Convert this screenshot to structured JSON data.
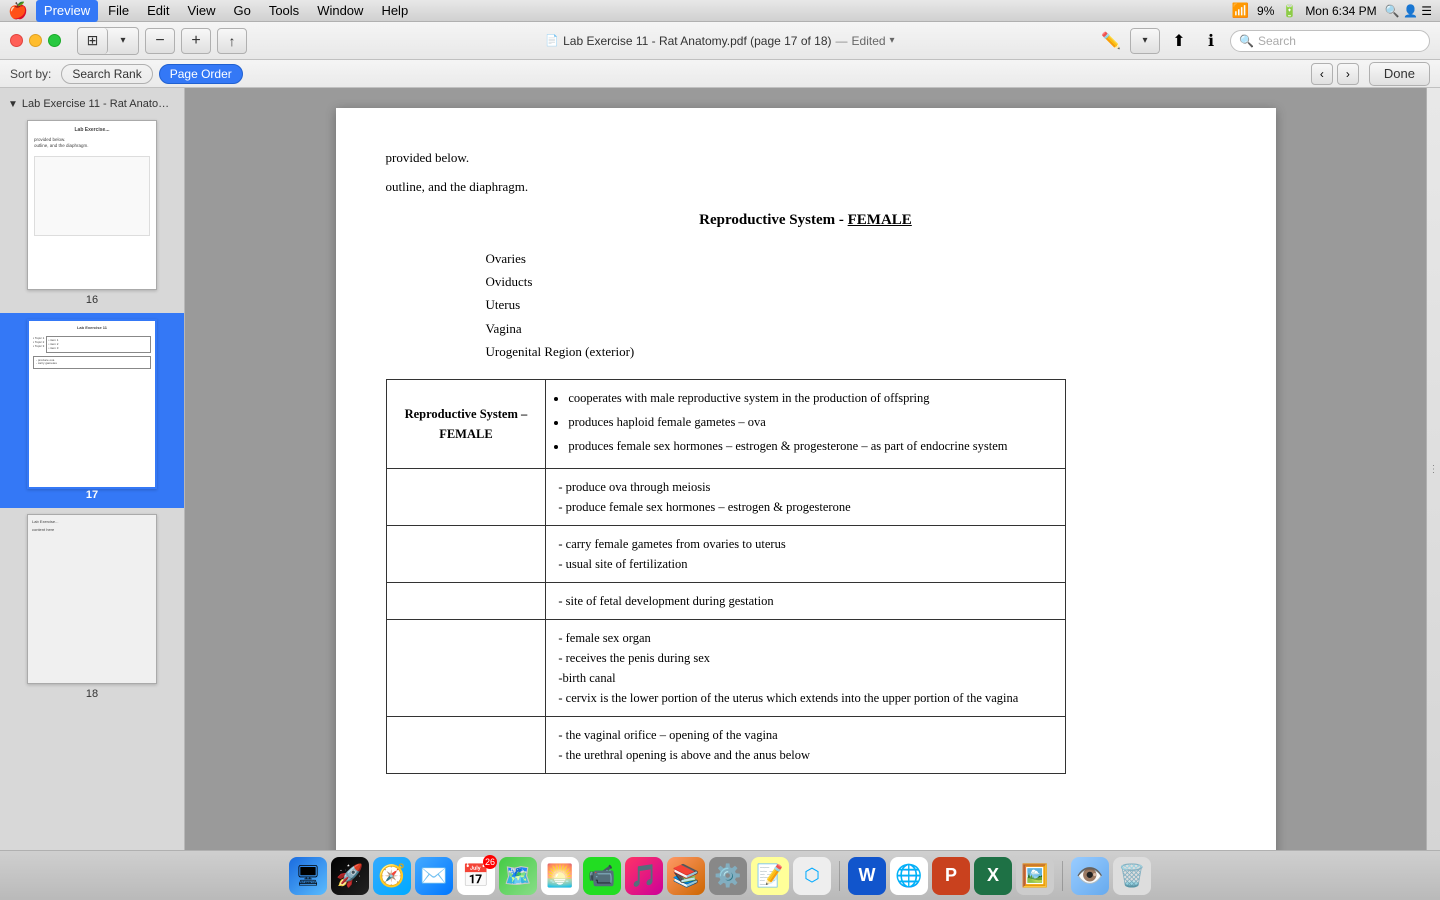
{
  "menubar": {
    "apple": "🍎",
    "items": [
      "Preview",
      "File",
      "Edit",
      "View",
      "Go",
      "Tools",
      "Window",
      "Help"
    ],
    "active": "Preview",
    "time": "Mon 6:34 PM",
    "battery": "9%"
  },
  "toolbar": {
    "title": "Lab Exercise 11 - Rat Anatomy.pdf (page 17 of 18)",
    "edited_label": "Edited",
    "search_placeholder": "Search"
  },
  "sortbar": {
    "sort_label": "Sort by:",
    "sort_buttons": [
      "Search Rank",
      "Page Order"
    ],
    "active_sort": "Page Order",
    "done_label": "Done"
  },
  "sidebar": {
    "pages": [
      {
        "num": "16",
        "active": false
      },
      {
        "num": "17",
        "active": true
      },
      {
        "num": "18",
        "active": false
      }
    ]
  },
  "document": {
    "page17": {
      "intro_text1": "provided below.",
      "intro_text2": "outline, and the diaphragm.",
      "section_title_prefix": "Reproductive System - ",
      "section_title_underline": "FEMALE",
      "list_items": [
        "Ovaries",
        "Oviducts",
        "Uterus",
        "Vagina",
        "Urogenital Region (exterior)"
      ],
      "table": {
        "header_col1": "Reproductive System – FEMALE",
        "rows": [
          {
            "col1": "",
            "col2_bullets": [
              "cooperates with male reproductive system in the production of offspring",
              "produces haploid female gametes – ova",
              "produces female sex hormones – estrogen & progesterone – as part of endocrine system"
            ]
          },
          {
            "col1": "",
            "col2_lines": [
              "- produce ova through meiosis",
              "- produce female sex hormones – estrogen & progesterone"
            ]
          },
          {
            "col1": "",
            "col2_lines": [
              "- carry female gametes from ovaries to uterus",
              "- usual site of fertilization"
            ]
          },
          {
            "col1": "",
            "col2_lines": [
              "- site of fetal development during gestation"
            ]
          },
          {
            "col1": "",
            "col2_lines": [
              "- female sex organ",
              "- receives the penis during sex",
              "-birth canal",
              "- cervix is the lower portion of the uterus which extends into the upper portion of the vagina"
            ]
          },
          {
            "col1": "",
            "col2_lines": [
              "- the vaginal orifice – opening of the vagina",
              "- the urethral opening is above and the anus below"
            ]
          }
        ]
      }
    }
  },
  "dock": {
    "icons": [
      {
        "name": "Finder",
        "emoji": "🔵",
        "badge": ""
      },
      {
        "name": "Launchpad",
        "emoji": "🚀",
        "badge": ""
      },
      {
        "name": "Safari",
        "emoji": "🧭",
        "badge": ""
      },
      {
        "name": "Mail",
        "emoji": "📧",
        "badge": ""
      },
      {
        "name": "Calendar",
        "emoji": "📅",
        "badge": "26"
      },
      {
        "name": "Maps",
        "emoji": "🗺️",
        "badge": ""
      },
      {
        "name": "Photos",
        "emoji": "🌅",
        "badge": ""
      },
      {
        "name": "FaceTime",
        "emoji": "📹",
        "badge": ""
      },
      {
        "name": "Music",
        "emoji": "🎵",
        "badge": ""
      },
      {
        "name": "Books",
        "emoji": "📚",
        "badge": ""
      },
      {
        "name": "SystemPrefs",
        "emoji": "⚙️",
        "badge": ""
      },
      {
        "name": "Stickies",
        "emoji": "📝",
        "badge": ""
      },
      {
        "name": "Bluetooth",
        "emoji": "🔷",
        "badge": ""
      },
      {
        "name": "Word",
        "emoji": "📘",
        "badge": ""
      },
      {
        "name": "Chrome",
        "emoji": "🌐",
        "badge": ""
      },
      {
        "name": "PowerPoint",
        "emoji": "📊",
        "badge": ""
      },
      {
        "name": "Excel",
        "emoji": "📗",
        "badge": ""
      },
      {
        "name": "Photos2",
        "emoji": "🖼️",
        "badge": ""
      },
      {
        "name": "Preview",
        "emoji": "👁️",
        "badge": ""
      },
      {
        "name": "Trash",
        "emoji": "🗑️",
        "badge": ""
      }
    ]
  }
}
